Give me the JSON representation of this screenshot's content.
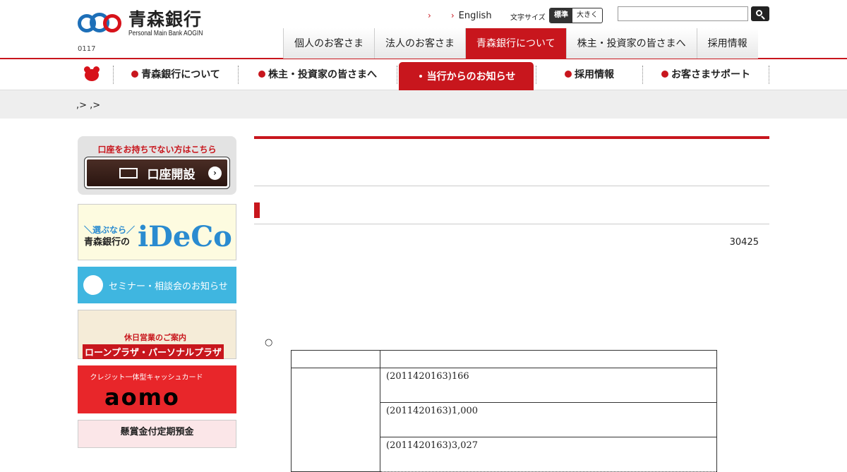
{
  "header": {
    "logo_name": "青森銀行",
    "logo_sub": "Personal Main Bank AOGIN",
    "code": "0117",
    "top_link_english": "English",
    "font_size_label": "文字サイズ",
    "font_size_standard": "標準",
    "font_size_large": "大きく",
    "tabs": [
      "個人のお客さま",
      "法人のお客さま",
      "青森銀行について",
      "株主・投資家の皆さまへ",
      "採用情報"
    ]
  },
  "subnav": {
    "items": [
      "青森銀行について",
      "株主・投資家の皆さまへ",
      "当行からのお知らせ",
      "採用情報",
      "お客さまサポート"
    ]
  },
  "breadcrumb": ",> ,>",
  "sidebar": {
    "kouza_title": "口座をお持ちでない方はこちら",
    "kouza_button": "口座開設",
    "ideco_line1": "＼選ぶなら／",
    "ideco_line2": "青森銀行の",
    "ideco_logo": "iDeCo",
    "seminar": "セミナー・相談会のお知らせ",
    "holiday_1": "休日営業のご案内",
    "holiday_2": "ローンプラザ・パーソナルプラザ",
    "aomo_sub": "クレジット一体型キャッシュカード",
    "aomo_logo": "aomo",
    "kenshou": "懸賞金付定期預金"
  },
  "main": {
    "date": "30425",
    "bullet": "○",
    "table_rows": [
      "(2011420163)166",
      "(2011420163)1,000",
      "(2011420163)3,027"
    ]
  }
}
